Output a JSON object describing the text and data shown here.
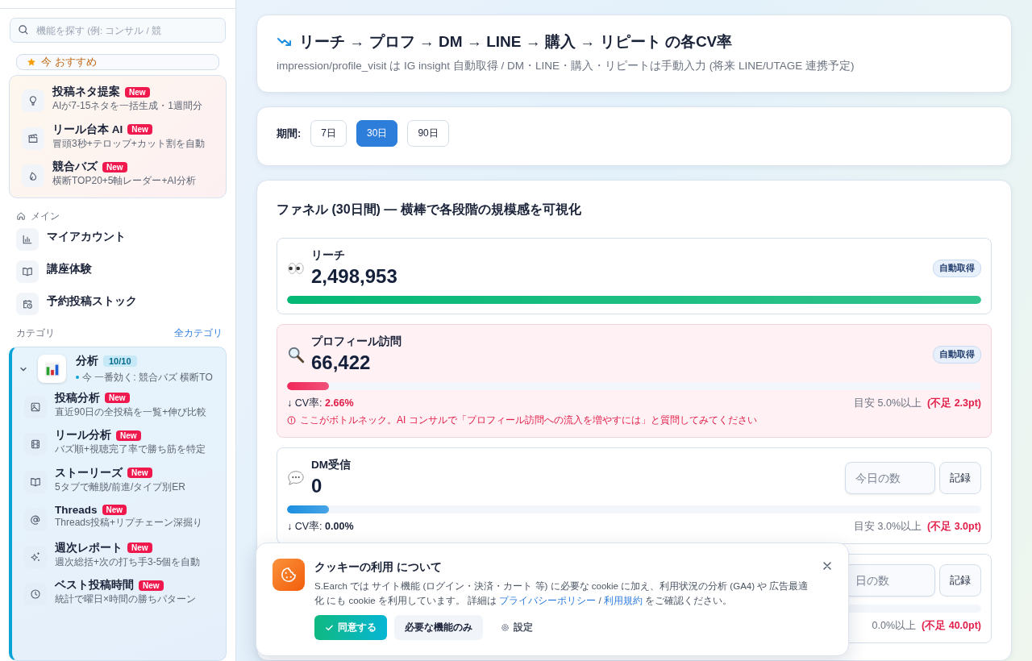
{
  "sidebar": {
    "search": {
      "placeholder": "機能を探す (例: コンサル / 競"
    },
    "recommended": {
      "heading": "今 おすすめ",
      "items": [
        {
          "title": "投稿ネタ提案",
          "badge": "New",
          "description": "AIが7-15ネタを一括生成・1週間分"
        },
        {
          "title": "リール台本 AI",
          "badge": "New",
          "description": "冒頭3秒+テロップ+カット割を自動"
        },
        {
          "title": "競合バズ",
          "badge": "New",
          "description": "横断TOP20+5軸レーダー+AI分析"
        }
      ]
    },
    "main": {
      "heading": "メイン",
      "items": [
        {
          "title": "マイアカウント"
        },
        {
          "title": "講座体験"
        },
        {
          "title": "予約投稿ストック"
        }
      ]
    },
    "categories": {
      "heading": "カテゴリ",
      "all_link": "全カテゴリ",
      "group": {
        "title": "分析",
        "count": "10/10",
        "hint": "今 一番効く: 競合バズ 横断TO",
        "expanded": true,
        "items": [
          {
            "title": "投稿分析",
            "badge": "New",
            "description": "直近90日の全投稿を一覧+伸び比較"
          },
          {
            "title": "リール分析",
            "badge": "New",
            "description": "バズ順+視聴完了率で勝ち筋を特定"
          },
          {
            "title": "ストーリーズ",
            "badge": "New",
            "description": "5タブで離脱/前進/タイプ別ER"
          },
          {
            "title": "Threads",
            "badge": "New",
            "description": "Threads投稿+リプチェーン深掘り"
          },
          {
            "title": "週次レポート",
            "badge": "New",
            "description": "週次総括+次の打ち手3-5個を自動"
          },
          {
            "title": "ベスト投稿時間",
            "badge": "New",
            "description": "統計で曜日×時間の勝ちパターン"
          }
        ]
      }
    }
  },
  "header": {
    "title": "リーチ → プロフ → DM → LINE → 購入 → リピート の各CV率",
    "subtitle": "impression/profile_visit は IG insight 自動取得 / DM・LINE・購入・リピートは手動入力 (将来 LINE/UTAGE 連携予定)"
  },
  "period": {
    "label": "期間:",
    "options": [
      {
        "label": "7日",
        "selected": false
      },
      {
        "label": "30日",
        "selected": true
      },
      {
        "label": "90日",
        "selected": false
      }
    ]
  },
  "funnel": {
    "title": "ファネル (30日間) — 横棒で各段階の規模感を可視化",
    "stages": [
      {
        "kind": "auto",
        "label": "リーチ",
        "value": "2,498,953",
        "badge": "自動取得",
        "level": 1,
        "color": "#03b874",
        "bottleneck": false
      },
      {
        "kind": "auto",
        "label": "プロフィール訪問",
        "value": "66,422",
        "badge": "自動取得",
        "level": 0.06,
        "color": "#f0285a",
        "bottleneck": true,
        "cv_label": "↓ CV率:",
        "cv_value": "2.66%",
        "target": "目安 5.0%以上",
        "shortfall": "(不足 2.3pt)",
        "warning": "ここがボトルネック。AI コンサルで「プロフィール訪問への流入を増やすには」と質問してみてください"
      },
      {
        "kind": "manual",
        "label": "DM受信",
        "value": "0",
        "placeholder": "今日の数",
        "button": "記録",
        "level": 0.06,
        "color": "#1c8fe0",
        "bottleneck": false,
        "cv_label": "↓ CV率:",
        "cv_value": "0.00%",
        "target": "目安 3.0%以上",
        "shortfall": "(不足 3.0pt)"
      },
      {
        "kind": "manual",
        "placeholder": "日の数",
        "button": "記録",
        "bottleneck": false,
        "target": "0.0%以上",
        "shortfall": "(不足 40.0pt)"
      }
    ]
  },
  "cookie_banner": {
    "title": "クッキーの利用 について",
    "text_before": "S.Earch では サイト機能 (ログイン・決済・カート 等) に必要な cookie に加え、利用状況の分析 (GA4) や 広告最適化 にも cookie を利用しています。 詳細は ",
    "privacy_link": "プライバシーポリシー",
    "separator": " / ",
    "terms_link": "利用規約",
    "text_after": " をご確認ください。",
    "accept": "同意する",
    "necessary_only": "必要な機能のみ",
    "settings": "設定"
  }
}
